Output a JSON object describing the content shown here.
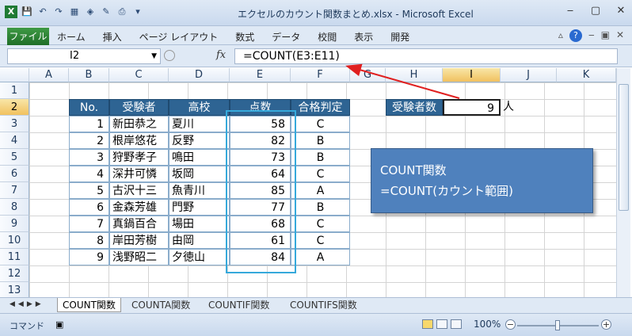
{
  "window": {
    "title": "エクセルのカウント関数まとめ.xlsx - Microsoft Excel",
    "controls": [
      "‒",
      "▢",
      "✕"
    ]
  },
  "ribbon": {
    "file_tab": "ファイル",
    "tabs": [
      "ホーム",
      "挿入",
      "ページ レイアウト",
      "数式",
      "データ",
      "校閲",
      "表示",
      "開発"
    ]
  },
  "formula_bar": {
    "name_box": "I2",
    "fx": "fx",
    "formula": "=COUNT(E3:E11)"
  },
  "columns": [
    "A",
    "B",
    "C",
    "D",
    "E",
    "F",
    "G",
    "H",
    "I",
    "J",
    "K"
  ],
  "selected_column": "I",
  "rows": [
    "1",
    "2",
    "3",
    "4",
    "5",
    "6",
    "7",
    "8",
    "9",
    "10",
    "11",
    "12",
    "13"
  ],
  "selected_row": "2",
  "table": {
    "headers": [
      "No.",
      "受験者",
      "高校",
      "点数",
      "合格判定"
    ],
    "rows": [
      [
        "1",
        "新田恭之",
        "夏川",
        "58",
        "C"
      ],
      [
        "2",
        "根岸悠花",
        "反野",
        "82",
        "B"
      ],
      [
        "3",
        "狩野孝子",
        "鳴田",
        "73",
        "B"
      ],
      [
        "4",
        "深井可憐",
        "坂岡",
        "64",
        "C"
      ],
      [
        "5",
        "古沢十三",
        "魚青川",
        "85",
        "A"
      ],
      [
        "6",
        "金森芳雄",
        "門野",
        "77",
        "B"
      ],
      [
        "7",
        "真鍋百合",
        "場田",
        "68",
        "C"
      ],
      [
        "8",
        "岸田芳樹",
        "由岡",
        "61",
        "C"
      ],
      [
        "9",
        "浅野昭二",
        "夕徳山",
        "84",
        "A"
      ]
    ]
  },
  "summary": {
    "label": "受験者数",
    "value": "9",
    "unit": "人"
  },
  "callout": {
    "line1": "COUNT関数",
    "line2": "=COUNT(カウント範囲)"
  },
  "sheet_tabs": [
    "COUNT関数",
    "COUNTA関数",
    "COUNTIF関数",
    "COUNTIFS関数"
  ],
  "active_sheet": "COUNT関数",
  "status": {
    "mode": "コマンド",
    "zoom": "100%"
  },
  "colors": {
    "header_fill": "#2e6493",
    "highlight_border": "#36a9db",
    "callout_fill": "#4f81bd",
    "arrow": "#e02020"
  }
}
